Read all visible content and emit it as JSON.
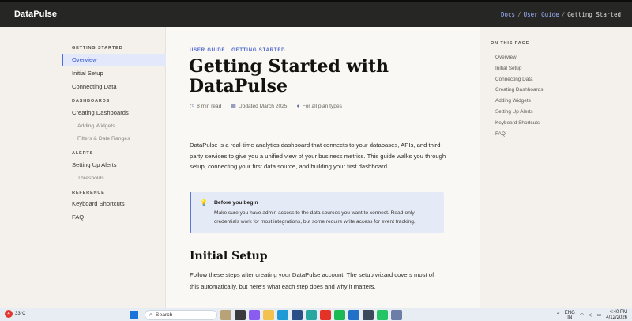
{
  "app": {
    "logo": "DataPulse"
  },
  "breadcrumb": {
    "docs": "Docs",
    "sep1": "/",
    "guide": "User Guide",
    "sep2": "/",
    "current": "Getting Started"
  },
  "sidebar": {
    "sections": [
      "GETTING STARTED",
      "DASHBOARDS",
      "ALERTS",
      "REFERENCE"
    ],
    "items": [
      "Overview",
      "Initial Setup",
      "Connecting Data",
      "Creating Dashboards",
      "Adding Widgets",
      "Filters & Date Ranges",
      "Setting Up Alerts",
      "Thresholds",
      "Keyboard Shortcuts",
      "FAQ"
    ]
  },
  "article": {
    "eyebrow": "USER GUIDE · GETTING STARTED",
    "title": "Getting Started with DataPulse",
    "meta": {
      "read": "8 min read",
      "updated": "Updated March 2025",
      "plans": "For all plan types"
    },
    "lead": "DataPulse is a real-time analytics dashboard that connects to your databases, APIs, and third-party services to give you a unified view of your business metrics. This guide walks you through setup, connecting your first data source, and building your first dashboard.",
    "callout": {
      "title": "Before you begin",
      "body": "Make sure you have admin access to the data sources you want to connect. Read-only credentials work for most integrations, but some require write access for event tracking."
    },
    "h2": "Initial Setup",
    "para2": "Follow these steps after creating your DataPulse account. The setup wizard covers most of this automatically, but here's what each step does and why it matters."
  },
  "toc": {
    "title": "ON THIS PAGE",
    "items": [
      "Overview",
      "Initial Setup",
      "Connecting Data",
      "Creating Dashboards",
      "Adding Widgets",
      "Setting Up Alerts",
      "Keyboard Shortcuts",
      "FAQ"
    ]
  },
  "taskbar": {
    "weather_badge": "4",
    "temp": "33°C",
    "search": "Search",
    "lang1": "ENG",
    "lang2": "IN",
    "time": "4:40 PM",
    "date": "4/12/2026"
  },
  "colors": {
    "accent": "#4a6ee0",
    "topbar": "#262624",
    "callout": "#e5eaf7"
  }
}
